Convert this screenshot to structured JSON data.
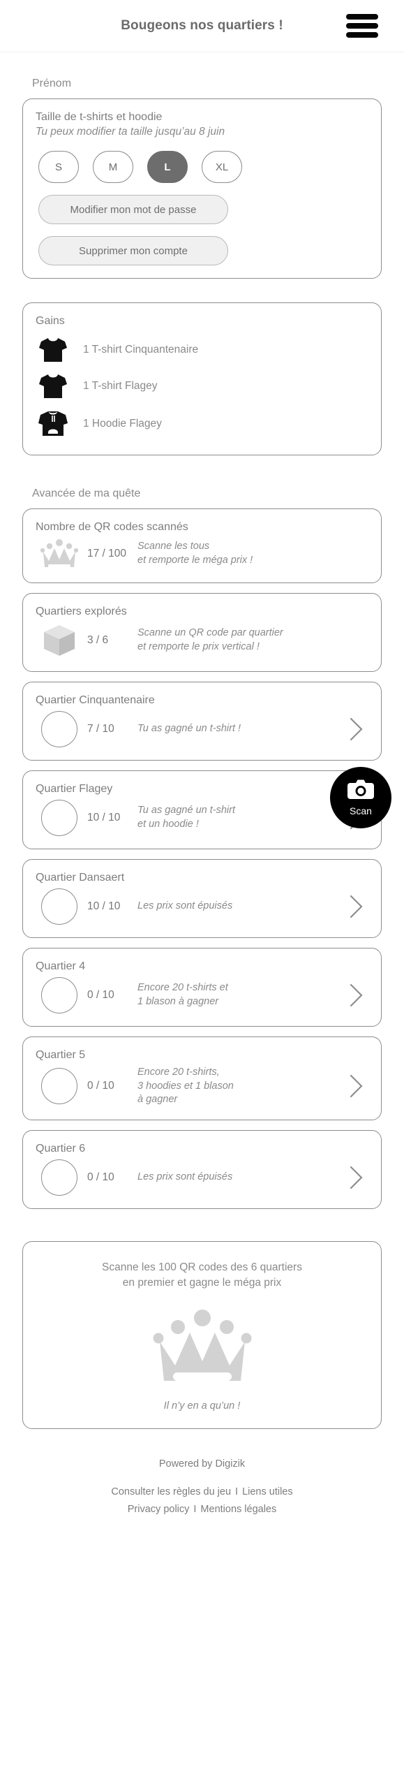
{
  "header": {
    "title": "Bougeons nos quartiers !",
    "menu_icon": "hamburger-menu-icon"
  },
  "profile": {
    "firstname_label": "Prénom",
    "size_card": {
      "title": "Taille de t-shirts et hoodie",
      "subtitle": "Tu peux modifier ta taille jusqu’au 8 juin",
      "sizes": [
        {
          "label": "S",
          "selected": false
        },
        {
          "label": "M",
          "selected": false
        },
        {
          "label": "L",
          "selected": true
        },
        {
          "label": "XL",
          "selected": false
        }
      ],
      "selected_size": "L",
      "change_password_label": "Modifier mon mot de passe",
      "delete_account_label": "Supprimer mon compte"
    }
  },
  "gains": {
    "title": "Gains",
    "items": [
      {
        "icon": "tshirt-icon",
        "label": "1 T-shirt Cinquantenaire"
      },
      {
        "icon": "tshirt-icon",
        "label": "1 T-shirt Flagey"
      },
      {
        "icon": "hoodie-icon",
        "label": "1 Hoodie Flagey"
      }
    ]
  },
  "quest": {
    "section_label": "Avancée de ma quête",
    "qr_card": {
      "title": "Nombre de QR codes scannés",
      "icon": "crown-icon",
      "count": "17 / 100",
      "desc_line1": "Scanne les tous",
      "desc_line2": "et remporte le méga prix !"
    },
    "districts_card": {
      "title": "Quartiers explorés",
      "icon": "cube-icon",
      "count": "3 / 6",
      "desc_line1": "Scanne un QR code par quartier",
      "desc_line2": "et remporte le prix vertical !"
    },
    "districts": [
      {
        "title": "Quartier Cinquantenaire",
        "count": "7 / 10",
        "desc_line1": "Tu as gagné un t-shirt !",
        "desc_line2": ""
      },
      {
        "title": "Quartier Flagey",
        "count": "10 / 10",
        "desc_line1": "Tu as gagné un t-shirt",
        "desc_line2": "et un hoodie !"
      },
      {
        "title": "Quartier Dansaert",
        "count": "10 / 10",
        "desc_line1": "Les prix sont épuisés",
        "desc_line2": ""
      },
      {
        "title": "Quartier 4",
        "count": "0 / 10",
        "desc_line1": "Encore 20 t-shirts et",
        "desc_line2": "1 blason à gagner"
      },
      {
        "title": "Quartier 5",
        "count": "0 / 10",
        "desc_line1": "Encore 20 t-shirts,",
        "desc_line2": "3 hoodies et 1 blason",
        "desc_line3": "à gagner"
      },
      {
        "title": "Quartier 6",
        "count": "0 / 10",
        "desc_line1": "Les prix sont épuisés",
        "desc_line2": ""
      }
    ]
  },
  "scan_button": {
    "label": "Scan",
    "icon": "camera-icon"
  },
  "mega": {
    "line1": "Scanne les 100 QR codes des 6 quartiers",
    "line2": "en premier et gagne le méga prix",
    "icon": "crown-icon",
    "note": "Il n’y en a qu’un !"
  },
  "footer": {
    "powered": "Powered by Digizik",
    "links_row1": [
      "Consulter les règles du jeu",
      "Liens utiles"
    ],
    "links_row2": [
      "Privacy policy",
      "Mentions légales"
    ],
    "separator": "I"
  },
  "colors": {
    "border": "#8d8d8d",
    "text": "#7d7d7d",
    "selected_bg": "#6d6d6d",
    "fab_bg": "#000000",
    "icon_gray": "#d2d2d2",
    "icon_black": "#111111"
  }
}
